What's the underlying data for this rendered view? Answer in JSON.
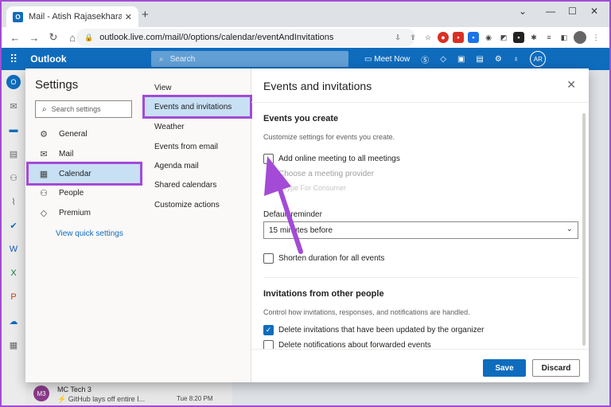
{
  "browser": {
    "tab_title": "Mail - Atish Rajasekharan - Outlo",
    "url": "outlook.live.com/mail/0/options/calendar/eventAndInvitations"
  },
  "header": {
    "brand": "Outlook",
    "search_placeholder": "Search",
    "meet_now": "Meet Now",
    "avatar_initials": "AR"
  },
  "settings": {
    "title": "Settings",
    "search_placeholder": "Search settings",
    "categories": [
      {
        "label": "General",
        "icon": "gear-icon"
      },
      {
        "label": "Mail",
        "icon": "mail-icon"
      },
      {
        "label": "Calendar",
        "icon": "calendar-icon"
      },
      {
        "label": "People",
        "icon": "people-icon"
      },
      {
        "label": "Premium",
        "icon": "diamond-icon"
      }
    ],
    "view_quick_settings": "View quick settings",
    "subcategories": [
      "View",
      "Events and invitations",
      "Weather",
      "Events from email",
      "Agenda mail",
      "Shared calendars",
      "Customize actions"
    ]
  },
  "pane": {
    "title": "Events and invitations",
    "events_heading": "Events you create",
    "events_desc": "Customize settings for events you create.",
    "add_online_meeting": "Add online meeting to all meetings",
    "choose_provider": "Choose a meeting provider",
    "provider_value": "Skype For Consumer",
    "default_reminder_label": "Default reminder",
    "default_reminder_value": "15 minutes before",
    "shorten_duration": "Shorten duration for all events",
    "invitations_heading": "Invitations from other people",
    "invitations_desc": "Control how invitations, responses, and notifications are handled.",
    "delete_updated": "Delete invitations that have been updated by the organizer",
    "delete_forwarded": "Delete notifications about forwarded events",
    "save": "Save",
    "discard": "Discard"
  },
  "background_message": {
    "initials": "M3",
    "sender": "MC Tech 3",
    "subject": "GitHub lays off entire I...",
    "time": "Tue 8:20 PM"
  },
  "colors": {
    "accent": "#0f6cbd",
    "highlight": "#a34bd6",
    "selected": "#c7e0f4"
  }
}
